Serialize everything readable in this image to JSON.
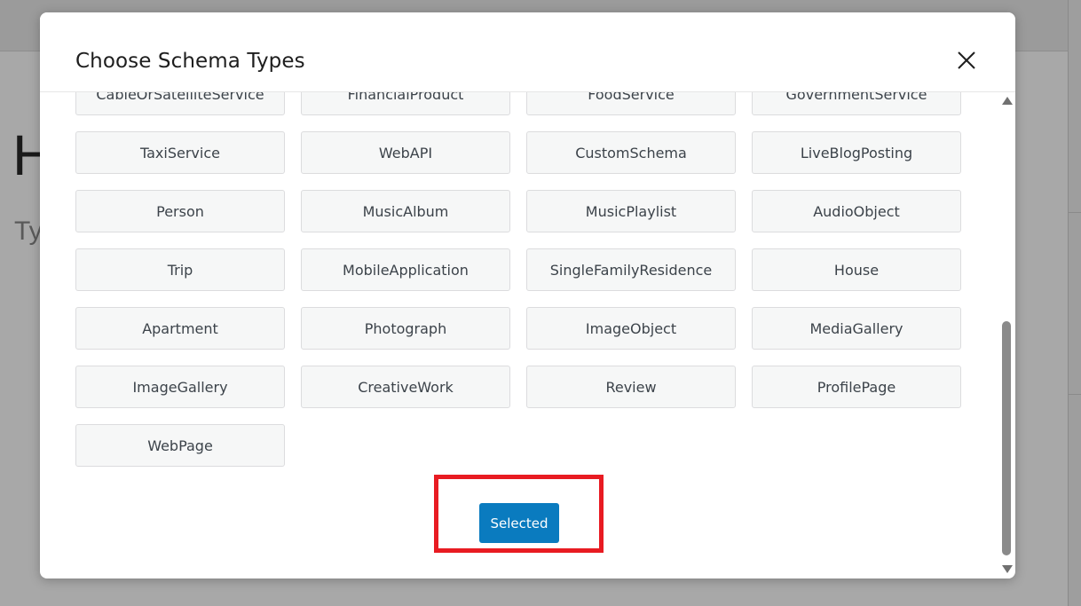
{
  "background": {
    "heading_fragment": "H",
    "sub_fragment": "Ty"
  },
  "modal": {
    "title": "Choose Schema Types",
    "close_icon": "close-icon",
    "schema_types": [
      "CableOrSatelliteService",
      "FinancialProduct",
      "FoodService",
      "GovernmentService",
      "TaxiService",
      "WebAPI",
      "CustomSchema",
      "LiveBlogPosting",
      "Person",
      "MusicAlbum",
      "MusicPlaylist",
      "AudioObject",
      "Trip",
      "MobileApplication",
      "SingleFamilyResidence",
      "House",
      "Apartment",
      "Photograph",
      "ImageObject",
      "MediaGallery",
      "ImageGallery",
      "CreativeWork",
      "Review",
      "ProfilePage",
      "WebPage"
    ],
    "selected_button_label": "Selected"
  },
  "colors": {
    "accent": "#0a7bbf",
    "highlight": "#e81b22"
  }
}
